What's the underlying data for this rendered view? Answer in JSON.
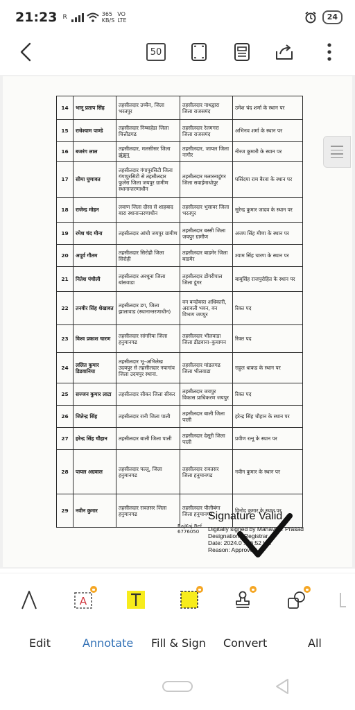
{
  "status": {
    "time": "21:23",
    "sim_label": "R",
    "speed_value": "365",
    "speed_unit": "KB/S",
    "net_type_top": "VO",
    "net_type_bottom": "LTE",
    "battery": "24"
  },
  "toolbar": {
    "page_count": "50",
    "back_icon": "arrow-left-icon",
    "fit_icon": "fit-screen-icon",
    "reader_icon": "reader-mode-icon",
    "share_icon": "share-icon",
    "more_icon": "more-vertical-icon"
  },
  "document": {
    "rows": [
      {
        "num": "14",
        "name": "भानू प्रताप सिंह",
        "c1": "तहसीलदार उच्चैन, जिला भरतपुर",
        "c2": "तहसीलदार नाथद्वारा जिला राजसमंद",
        "c3": "उमेश चंद शर्मा के स्थान पर"
      },
      {
        "num": "15",
        "name": "राधेश्याम पाण्डे",
        "c1": "तहसीलदार निम्बाहेडा जिला चित्तौडगढ",
        "c2": "तहसीलदार रेलमगरा जिला राजसमंद",
        "c3": "अभिनव शर्मा के स्थान पर"
      },
      {
        "num": "16",
        "name": "बजरंग लाल",
        "c1": "तहसीलदार, मलसीसर जिला झुंझुनू",
        "c2": "तहसीलदार, जायल जिला नागौर",
        "c3": "नीरज कुमारी के स्थान पर"
      },
      {
        "num": "17",
        "name": "सीमा घुणावत",
        "c1": "तहसीलदार गंगापुरसिटी जिला गंगापुरसिटी से तहसीलदार फुलेरा जिला जयपुर ग्रामीण स्थानान्तरणाधीन",
        "c2": "तहसीलदार मलारनाडूंगर जिला सवाईमाधोपुर",
        "c3": "घसिंदया राम बैरवा के स्थान पर"
      },
      {
        "num": "18",
        "name": "राजेन्द्र मोहन",
        "c1": "लवाण जिला दौसा से शाहबाद बारा स्थानान्तरणाधीन",
        "c2": "तहसीलदार भुसावर जिला भरतपुर",
        "c3": "सुरेन्द्र कुमार जादव के स्थान पर"
      },
      {
        "num": "19",
        "name": "रमेश चंद मीना",
        "c1": "तहसीलदार आंधी जयपुर ग्रामीण",
        "c2": "तहसीलदार बस्सी जिला जयपुर ग्रामीण",
        "c3": "अजय सिंह मीणा के स्थान पर"
      },
      {
        "num": "20",
        "name": "अपूर्व गौतम",
        "c1": "तहसीलदार सिरोही जिला सिरोही",
        "c2": "तहसीलदार बाडमेर जिला बाडमेर",
        "c3": "श्याम सिंह चारण के स्थान पर"
      },
      {
        "num": "21",
        "name": "नितेश पंचौली",
        "c1": "तहसीलदार अरथूना जिला बांसवाडा",
        "c2": "तहसीलदार डोंगरीपाल जिला डूंगर",
        "c3": "बाबूसिंह राजपुरोहित के स्थान पर"
      },
      {
        "num": "22",
        "name": "तनवीर सिंह शेखावत",
        "c1": "तहसीलदार डग, जिला झालावाड (स्थानान्तरणाधीन)",
        "c2": "वन बन्दोबस्त अधिकारी, अरावली भवन, वन विभाग जयपुर",
        "c3": "रिक्त पद"
      },
      {
        "num": "23",
        "name": "विश्व प्रकाश चारण",
        "c1": "तहसीलदार सांगरिया जिला हनुमानगढ",
        "c2": "तहसीलदार भीलवाडा जिला डीडवाना–कुचामन",
        "c3": "रिक्त पद"
      },
      {
        "num": "24",
        "name": "ललित कुमार डिडवानिया",
        "c1": "तहसीलदार भू–अभिलेख उदयपुर से तहसीलदार नयागांव जिला उदयपुर स्थाना.",
        "c2": "तहसीलदार मांडलगढ जिला भीलवाडा",
        "c3": "राहुल धाकड के स्थान पर"
      },
      {
        "num": "25",
        "name": "सज्जन कुमार लाटा",
        "c1": "तहसीलदार सीकर जिला सीकर",
        "c2": "तहसीलदार जयपुर विकास प्राधिकरण जयपुर",
        "c3": "रिक्त पद"
      },
      {
        "num": "26",
        "name": "जितेन्द्र सिंह",
        "c1": "तहसीलदार रानी जिला पाली",
        "c2": "तहसीलदार बाली जिला पाली",
        "c3": "हरेन्द्र सिंह चौहान के स्थान पर"
      },
      {
        "num": "27",
        "name": "हरेन्द्र सिंह चौहान",
        "c1": "तहसीलदार बाली जिला पाली",
        "c2": "तहसीलदार देसूरी जिला पाली",
        "c3": "प्रवीण रत्नू के स्थान पर"
      },
      {
        "num": "28",
        "name": "पायल अग्रवाल",
        "c1": "तहसीलदार पल्लू, जिला हनुमानगढ",
        "c2": "तहसीलदार रावतसर जिला हनुमानगढ",
        "c3": "नवीन कुमार के स्थान पर"
      },
      {
        "num": "29",
        "name": "नवीन कुमार",
        "c1": "तहसीलदार रावतसर जिला हनुमानगढ",
        "c2": "तहसीलदार पीलीबंगा जिला हनुमानगढ",
        "c3": "विनोद कुमार के स्थान पर"
      }
    ],
    "ref_line1": "RajKaj Ref",
    "ref_line2": "6776050",
    "signature": {
      "title": "Signature Valid",
      "line1": "Digitally signed by Mahaveer Prasad",
      "line2": "Designation : Registrar",
      "line3": "Date: 2024.0 .  16:52 IST",
      "line4": "Reason: Approved"
    }
  },
  "tools": [
    {
      "name": "pen-icon",
      "premium": false
    },
    {
      "name": "text-box-icon",
      "premium": true
    },
    {
      "name": "highlight-text-icon",
      "premium": false
    },
    {
      "name": "highlight-area-icon",
      "premium": true
    },
    {
      "name": "stamp-icon",
      "premium": true
    },
    {
      "name": "shapes-icon",
      "premium": true
    }
  ],
  "tabs": [
    {
      "label": "Edit"
    },
    {
      "label": "Annotate"
    },
    {
      "label": "Fill & Sign"
    },
    {
      "label": "Convert"
    },
    {
      "label": "All"
    }
  ],
  "colors": {
    "accent": "#2f6fb5",
    "highlight": "#f7ec1c",
    "premium": "#f5a623"
  }
}
